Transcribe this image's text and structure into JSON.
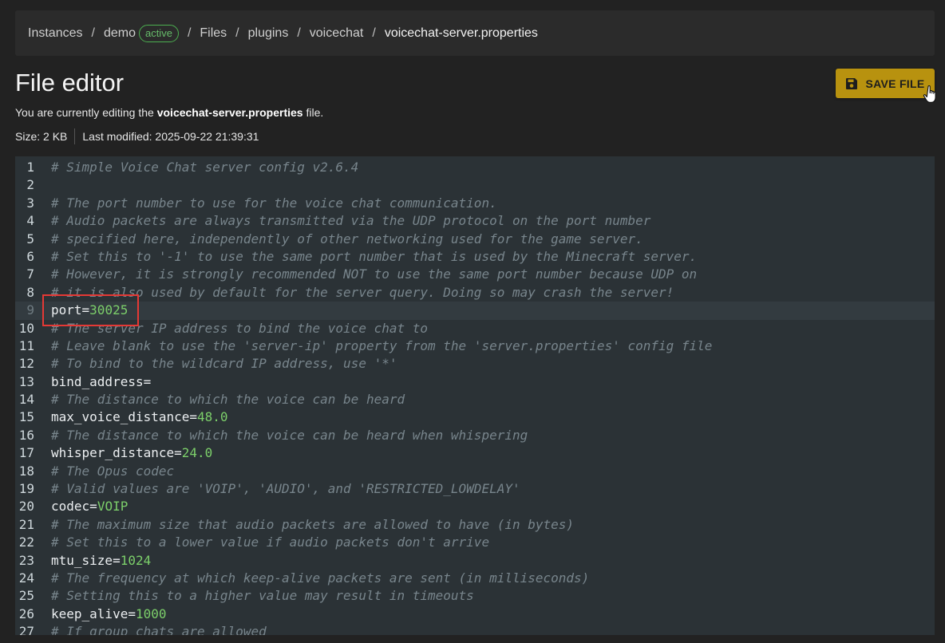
{
  "breadcrumb": {
    "items": [
      "Instances",
      "demo",
      "Files",
      "plugins",
      "voicechat",
      "voicechat-server.properties"
    ],
    "separator": "/",
    "badge": "active"
  },
  "header": {
    "title": "File editor",
    "editing_prefix": "You are currently editing the ",
    "editing_file": "voicechat-server.properties",
    "editing_suffix": " file.",
    "size": "Size: 2 KB",
    "last_modified": "Last modified: 2025-09-22 21:39:31"
  },
  "toolbar": {
    "save_label": "SAVE FILE",
    "save_icon": "floppy-disk-icon",
    "accent_color": "#b8920f"
  },
  "editor": {
    "active_line": 9,
    "lines": [
      {
        "n": "1",
        "type": "comment",
        "text": "# Simple Voice Chat server config v2.6.4"
      },
      {
        "n": "2",
        "type": "blank",
        "text": ""
      },
      {
        "n": "3",
        "type": "comment",
        "text": "# The port number to use for the voice chat communication."
      },
      {
        "n": "4",
        "type": "comment",
        "text": "# Audio packets are always transmitted via the UDP protocol on the port number"
      },
      {
        "n": "5",
        "type": "comment",
        "text": "# specified here, independently of other networking used for the game server."
      },
      {
        "n": "6",
        "type": "comment",
        "text": "# Set this to '-1' to use the same port number that is used by the Minecraft server."
      },
      {
        "n": "7",
        "type": "comment",
        "text": "# However, it is strongly recommended NOT to use the same port number because UDP on"
      },
      {
        "n": "8",
        "type": "comment",
        "text": "# it is also used by default for the server query. Doing so may crash the server!"
      },
      {
        "n": "9",
        "type": "kv",
        "key": "port",
        "value": "30025"
      },
      {
        "n": "10",
        "type": "comment",
        "text": "# The server IP address to bind the voice chat to"
      },
      {
        "n": "11",
        "type": "comment",
        "text": "# Leave blank to use the 'server-ip' property from the 'server.properties' config file"
      },
      {
        "n": "12",
        "type": "comment",
        "text": "# To bind to the wildcard IP address, use '*'"
      },
      {
        "n": "13",
        "type": "kv",
        "key": "bind_address",
        "value": ""
      },
      {
        "n": "14",
        "type": "comment",
        "text": "# The distance to which the voice can be heard"
      },
      {
        "n": "15",
        "type": "kv",
        "key": "max_voice_distance",
        "value": "48.0"
      },
      {
        "n": "16",
        "type": "comment",
        "text": "# The distance to which the voice can be heard when whispering"
      },
      {
        "n": "17",
        "type": "kv",
        "key": "whisper_distance",
        "value": "24.0"
      },
      {
        "n": "18",
        "type": "comment",
        "text": "# The Opus codec"
      },
      {
        "n": "19",
        "type": "comment",
        "text": "# Valid values are 'VOIP', 'AUDIO', and 'RESTRICTED_LOWDELAY'"
      },
      {
        "n": "20",
        "type": "kv",
        "key": "codec",
        "value": "VOIP"
      },
      {
        "n": "21",
        "type": "comment",
        "text": "# The maximum size that audio packets are allowed to have (in bytes)"
      },
      {
        "n": "22",
        "type": "comment",
        "text": "# Set this to a lower value if audio packets don't arrive"
      },
      {
        "n": "23",
        "type": "kv",
        "key": "mtu_size",
        "value": "1024"
      },
      {
        "n": "24",
        "type": "comment",
        "text": "# The frequency at which keep-alive packets are sent (in milliseconds)"
      },
      {
        "n": "25",
        "type": "comment",
        "text": "# Setting this to a higher value may result in timeouts"
      },
      {
        "n": "26",
        "type": "kv",
        "key": "keep_alive",
        "value": "1000"
      },
      {
        "n": "27",
        "type": "comment",
        "text": "# If group chats are allowed"
      }
    ]
  }
}
